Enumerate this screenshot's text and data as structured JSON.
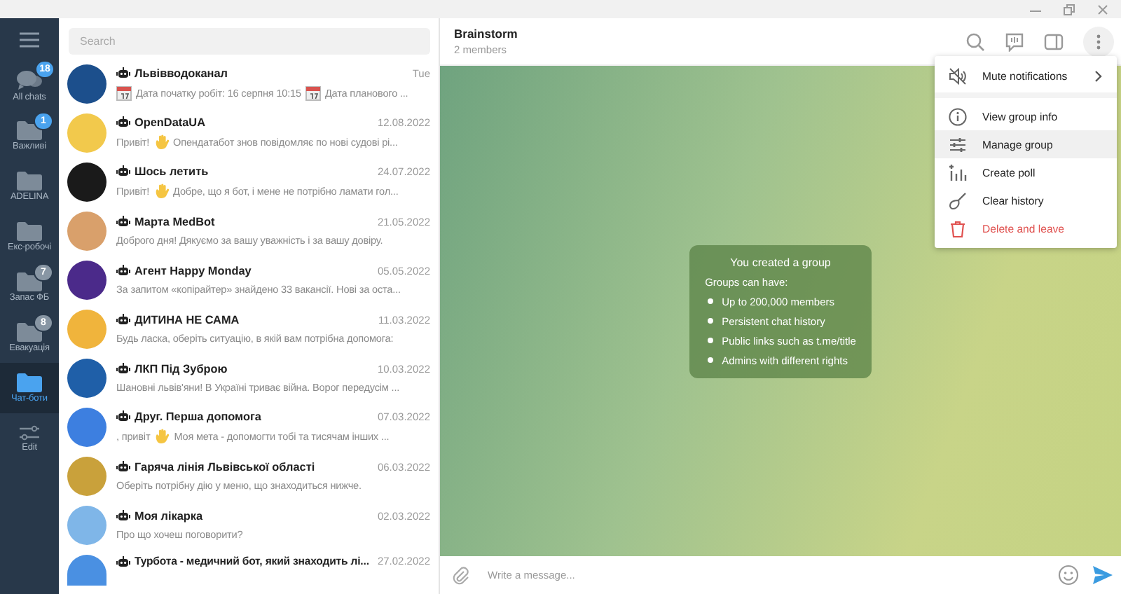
{
  "folders": [
    {
      "label": "All chats",
      "badge": "18",
      "selected": false
    },
    {
      "label": "Важливі",
      "badge": "1",
      "selected": false
    },
    {
      "label": "ADELINA",
      "selected": false
    },
    {
      "label": "Екс-робочі",
      "selected": false
    },
    {
      "label": "Запас ФБ",
      "badge": "7",
      "selected": false
    },
    {
      "label": "Евакуація",
      "badge": "8",
      "selected": false
    },
    {
      "label": "Чат-боти",
      "selected": true
    },
    {
      "label": "Edit",
      "kind": "edit",
      "selected": false
    }
  ],
  "search": {
    "placeholder": "Search"
  },
  "chats": [
    {
      "name": "Львівводоканал",
      "time": "Tue",
      "color": "#1c4f8c",
      "preview": [
        {
          "kind": "calendar"
        },
        {
          "kind": "text",
          "text": "Дата початку робіт: 16 серпня 10:15"
        },
        {
          "kind": "calendar"
        },
        {
          "kind": "text",
          "text": "Дата планового ..."
        }
      ]
    },
    {
      "name": "OpenDataUA",
      "time": "12.08.2022",
      "color": "#f2c94c",
      "preview": [
        {
          "kind": "text",
          "text": "Привіт!"
        },
        {
          "kind": "wave"
        },
        {
          "kind": "text",
          "text": "Опендатабот знов повідомляє по нові судові рі..."
        }
      ]
    },
    {
      "name": "Шось летить",
      "time": "24.07.2022",
      "color": "#1a1a1a",
      "preview": [
        {
          "kind": "text",
          "text": "Привіт!"
        },
        {
          "kind": "wave"
        },
        {
          "kind": "text",
          "text": "Добре, що я бот, і мене не потрібно ламати гол..."
        }
      ]
    },
    {
      "name": "Марта MedBot",
      "time": "21.05.2022",
      "color": "#d9a06b",
      "preview": [
        {
          "kind": "text",
          "text": "Доброго дня! Дякуємо за вашу уважність і за вашу довіру."
        }
      ]
    },
    {
      "name": "Агент Happy Monday",
      "time": "05.05.2022",
      "color": "#4b2a8a",
      "preview": [
        {
          "kind": "text",
          "text": "За запитом «копірайтер» знайдено 33 вакансії.  Нові за оста..."
        }
      ]
    },
    {
      "name": "ДИТИНА НЕ САМА",
      "time": "11.03.2022",
      "color": "#f0b43c",
      "preview": [
        {
          "kind": "text",
          "text": "Будь ласка, оберіть ситуацію, в якій вам потрібна допомога:"
        }
      ]
    },
    {
      "name": "ЛКП Під Зуброю",
      "time": "10.03.2022",
      "color": "#1f5fa8",
      "preview": [
        {
          "kind": "text",
          "text": "Шановні львів'яни!  В Україні триває війна. Ворог передусім ..."
        }
      ]
    },
    {
      "name": "Друг. Перша допомога",
      "time": "07.03.2022",
      "color": "#3d7fe0",
      "preview": [
        {
          "kind": "text",
          "text": ", привіт"
        },
        {
          "kind": "wave"
        },
        {
          "kind": "text",
          "text": "Моя мета - допомогти тобі та тисячам інших ..."
        }
      ]
    },
    {
      "name": "Гаряча лінія Львівської області",
      "time": "06.03.2022",
      "color": "#c9a13b",
      "preview": [
        {
          "kind": "text",
          "text": "Оберіть потрібну дію у меню, що знаходиться нижче."
        }
      ]
    },
    {
      "name": "Моя лікарка",
      "time": "02.03.2022",
      "color": "#7fb6e8",
      "preview": [
        {
          "kind": "text",
          "text": "Про що хочеш поговорити?"
        }
      ]
    },
    {
      "name": "Турбота - медичний бот, який знаходить лі...",
      "time": "27.02.2022",
      "color": "#4a90e2"
    }
  ],
  "chat": {
    "title": "Brainstorm",
    "subtitle": "2 members"
  },
  "service": {
    "title": "You created a group",
    "intro": "Groups can have:",
    "bullets": [
      "Up to 200,000 members",
      "Persistent chat history",
      "Public links such as t.me/title",
      "Admins with different rights"
    ]
  },
  "menu": [
    {
      "label": "Mute notifications",
      "kind": "mute",
      "submenu": true,
      "selected": false
    },
    {
      "label": "View group info",
      "kind": "info",
      "selected": false
    },
    {
      "label": "Manage group",
      "kind": "manage",
      "selected": true
    },
    {
      "label": "Create poll",
      "kind": "poll",
      "selected": false
    },
    {
      "label": "Clear history",
      "kind": "clear",
      "selected": false
    },
    {
      "label": "Delete and leave",
      "kind": "delete",
      "danger": true,
      "selected": false
    }
  ],
  "composer": {
    "placeholder": "Write a message..."
  }
}
